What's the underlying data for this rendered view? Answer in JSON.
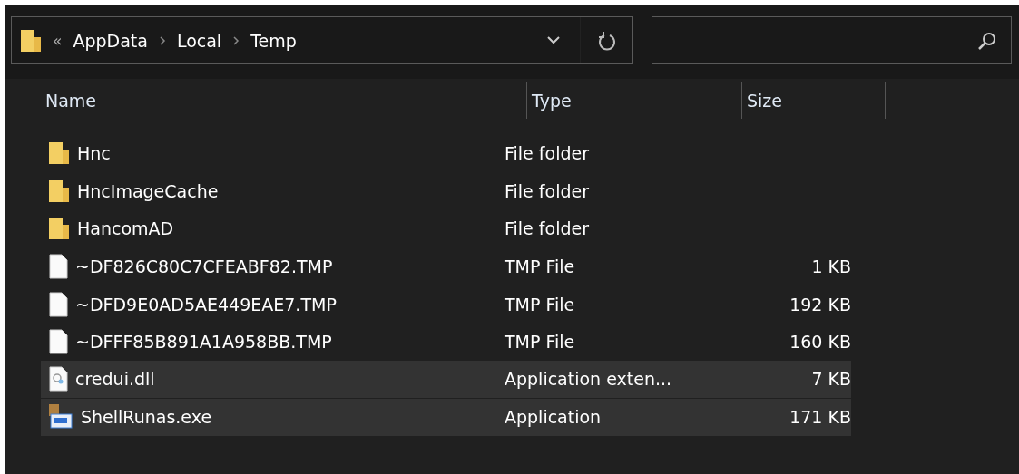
{
  "address_bar": {
    "overflow": "«",
    "breadcrumbs": [
      "AppData",
      "Local",
      "Temp"
    ]
  },
  "table": {
    "columns": [
      "Name",
      "Type",
      "Size"
    ],
    "rows": [
      {
        "kind": "folder",
        "name": "Hnc",
        "type": "File folder",
        "selected": false
      },
      {
        "kind": "folder",
        "name": "HncImageCache",
        "type": "File folder",
        "selected": false
      },
      {
        "kind": "folder",
        "name": "HancomAD",
        "type": "File folder",
        "selected": false
      },
      {
        "kind": "file",
        "name": "~DF826C80C7CFEABF82.TMP",
        "type": "TMP File",
        "size": "1 KB",
        "selected": false
      },
      {
        "kind": "file",
        "name": "~DFD9E0AD5AE449EAE7.TMP",
        "type": "TMP File",
        "size": "192 KB",
        "selected": false
      },
      {
        "kind": "file",
        "name": "~DFFF85B891A1A958BB.TMP",
        "type": "TMP File",
        "size": "160 KB",
        "selected": false
      },
      {
        "kind": "dll",
        "name": "credui.dll",
        "type": "Application exten...",
        "size": "7 KB",
        "selected": true
      },
      {
        "kind": "exe",
        "name": "ShellRunas.exe",
        "type": "Application",
        "size": "171 KB",
        "selected": true
      }
    ]
  }
}
